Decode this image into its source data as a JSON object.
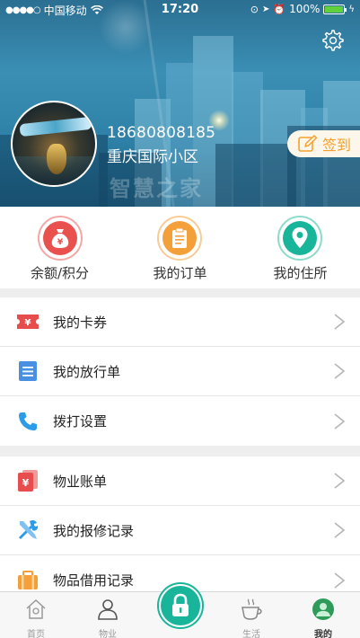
{
  "status_bar": {
    "carrier": "中国移动",
    "time": "17:20",
    "battery": "100%"
  },
  "profile": {
    "phone": "18680808185",
    "community": "重庆国际小区",
    "signin_label": "签到",
    "watermark": "智慧之家"
  },
  "quick_actions": [
    {
      "label": "余额/积分",
      "icon": "money-bag-icon",
      "color": "#e9514f"
    },
    {
      "label": "我的订单",
      "icon": "clipboard-icon",
      "color": "#f3a03a"
    },
    {
      "label": "我的住所",
      "icon": "location-pin-icon",
      "color": "#18b59a"
    }
  ],
  "menu_group_1": [
    {
      "label": "我的卡券",
      "icon": "coupon-icon",
      "color": "#e84d4d"
    },
    {
      "label": "我的放行单",
      "icon": "document-icon",
      "color": "#4a90e2"
    },
    {
      "label": "拨打设置",
      "icon": "phone-icon",
      "color": "#2c9be8"
    }
  ],
  "menu_group_2": [
    {
      "label": "物业账单",
      "icon": "bill-icon",
      "color": "#e84d4d"
    },
    {
      "label": "我的报修记录",
      "icon": "repair-tools-icon",
      "color": "#2c9be8"
    },
    {
      "label": "物品借用记录",
      "icon": "borrow-box-icon",
      "color": "#f3a03a"
    }
  ],
  "tab_bar": {
    "tabs": [
      {
        "label": "首页",
        "icon": "home-icon"
      },
      {
        "label": "物业",
        "icon": "person-icon"
      },
      {
        "label": "生活",
        "icon": "coffee-cup-icon"
      },
      {
        "label": "我的",
        "icon": "avatar-icon"
      }
    ],
    "active": "我的",
    "center_icon": "lock-icon"
  }
}
